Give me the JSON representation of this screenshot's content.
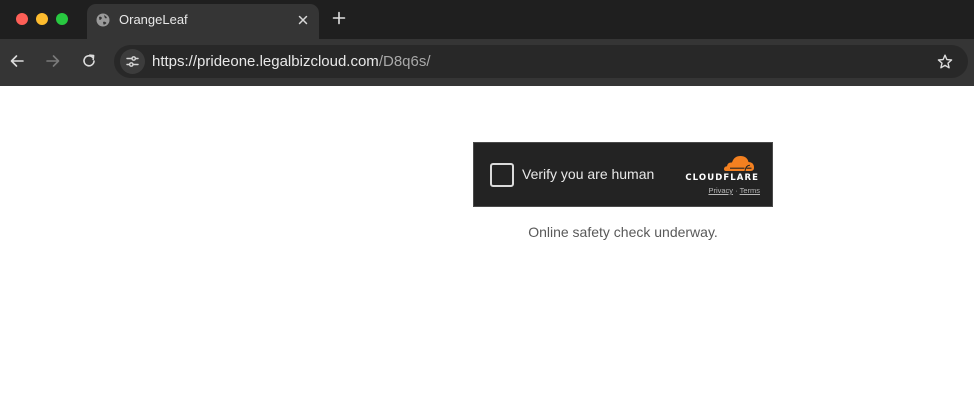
{
  "browser": {
    "tab": {
      "title": "OrangeLeaf",
      "favicon": "globe-icon"
    },
    "address_bar": {
      "host": "https://prideone.legalbizcloud.com",
      "path": "/D8q6s/"
    },
    "icons": {
      "back": "arrow-left-icon",
      "forward": "arrow-right-icon",
      "reload": "reload-icon",
      "site_info": "tune-icon",
      "bookmark": "star-icon",
      "close_tab": "close-icon",
      "new_tab": "plus-icon"
    }
  },
  "challenge": {
    "checkbox_label": "Verify you are human",
    "brand": "CLOUDFLARE",
    "privacy_link": "Privacy",
    "separator": "·",
    "terms_link": "Terms",
    "status": "Online safety check underway.",
    "accent_color": "#f38020"
  }
}
